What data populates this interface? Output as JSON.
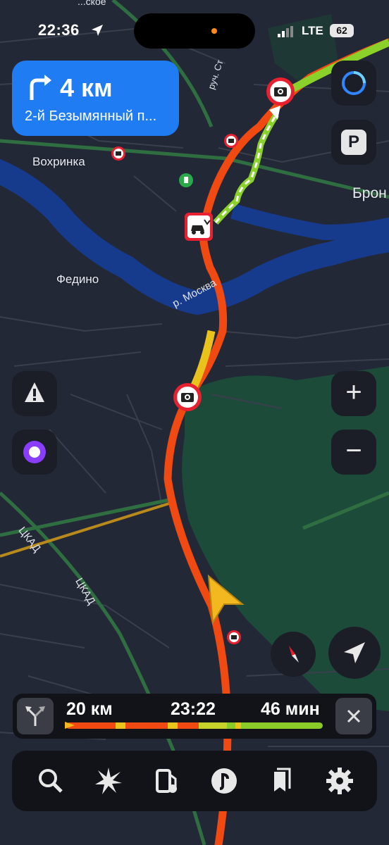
{
  "status_bar": {
    "time": "22:36",
    "network": "LTE",
    "battery": "62"
  },
  "maneuver": {
    "distance": "4 км",
    "street": "2-й Безымянный п...",
    "icon": "turn-right-arrow-icon"
  },
  "map": {
    "places": [
      "Вохринка",
      "Федино",
      "Брон"
    ],
    "rivers": [
      "р. Москва"
    ],
    "roads": [
      "ЦКАД",
      "ЦКАД",
      "руч. Ст"
    ],
    "top_cut_label": "...ское"
  },
  "buttons": {
    "alice_right": "alice-icon",
    "parking": "P",
    "hazard": "warning-icon",
    "alice_left": "alice-icon",
    "zoom_in": "+",
    "zoom_out": "−",
    "compass": "compass-icon",
    "locate": "navigation-arrow-icon"
  },
  "trip": {
    "distance": "20 км",
    "eta": "23:22",
    "duration": "46 мин"
  },
  "toolbar": [
    "search-icon",
    "discover-icon",
    "gas-station-icon",
    "music-icon",
    "bookmarks-icon",
    "settings-icon"
  ],
  "colors": {
    "maneuver_bg": "#1f7cf2",
    "route_jam": "#f04a12",
    "route_slow": "#e9c21c",
    "route_free": "#8ad22a",
    "water": "#163a8c",
    "forest": "#1c4b3a"
  }
}
